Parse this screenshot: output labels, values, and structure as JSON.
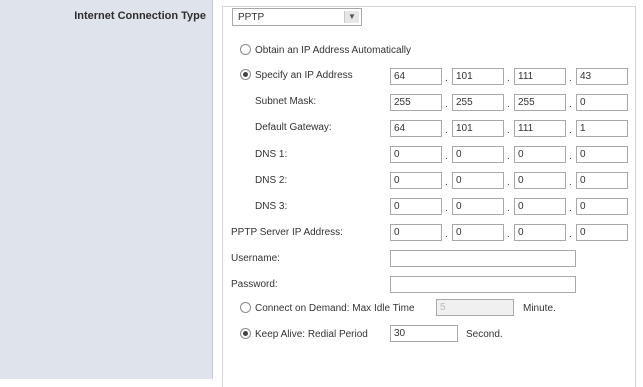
{
  "section": {
    "title": "Internet Connection Type"
  },
  "connection_type": {
    "selected": "PPTP"
  },
  "ip_mode": {
    "obtain_label": "Obtain an IP Address Automatically",
    "specify_label": "Specify an IP Address",
    "obtain_selected": false,
    "specify_selected": true
  },
  "fields": {
    "ip_address": [
      "64",
      "101",
      "111",
      "43"
    ],
    "subnet_mask_label": "Subnet Mask:",
    "subnet_mask": [
      "255",
      "255",
      "255",
      "0"
    ],
    "default_gateway_label": "Default Gateway:",
    "default_gateway": [
      "64",
      "101",
      "111",
      "1"
    ],
    "dns1_label": "DNS 1:",
    "dns1": [
      "0",
      "0",
      "0",
      "0"
    ],
    "dns2_label": "DNS 2:",
    "dns2": [
      "0",
      "0",
      "0",
      "0"
    ],
    "dns3_label": "DNS 3:",
    "dns3": [
      "0",
      "0",
      "0",
      "0"
    ],
    "pptp_server_label": "PPTP Server IP Address:",
    "pptp_server": [
      "0",
      "0",
      "0",
      "0"
    ]
  },
  "credentials": {
    "username_label": "Username:",
    "username_value": "",
    "password_label": "Password:",
    "password_value": ""
  },
  "connect_mode": {
    "on_demand_label": "Connect on Demand: Max Idle Time",
    "on_demand_value": "5",
    "on_demand_unit": "Minute.",
    "keep_alive_label": "Keep Alive: Redial Period",
    "keep_alive_value": "30",
    "keep_alive_unit": "Second.",
    "on_demand_selected": false,
    "keep_alive_selected": true
  },
  "ip_separator": "."
}
